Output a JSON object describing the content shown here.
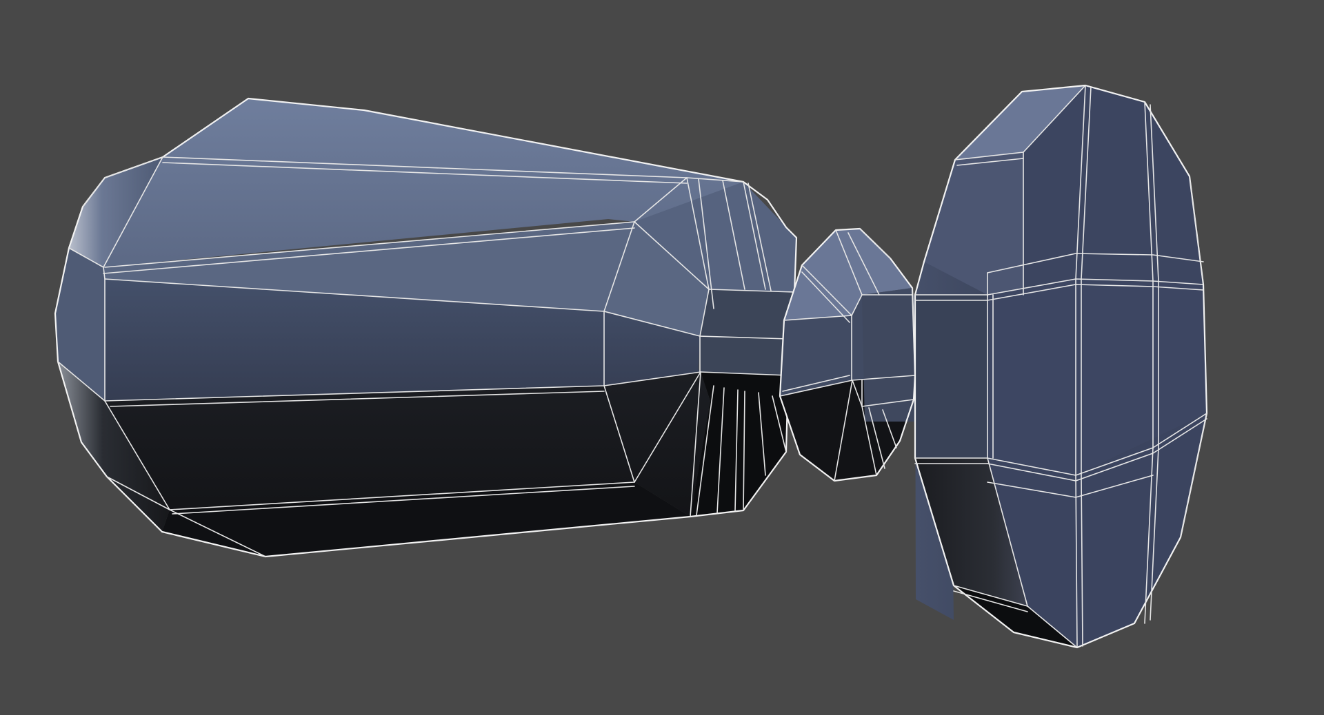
{
  "viewport": {
    "background_color": "#484848",
    "display_mode": "shaded-wireframe",
    "object": "handle-knob-mesh"
  },
  "colors": {
    "face_light": "#6c7a98",
    "face_mid": "#5a6782",
    "face_dark": "#3a4358",
    "face_shadow": "#1a1c20",
    "face_black": "#0e0f12",
    "wire": "#e6e6e6"
  },
  "icons": [
    "grip-handle-mesh",
    "collar-mesh",
    "knob-cap-mesh"
  ]
}
